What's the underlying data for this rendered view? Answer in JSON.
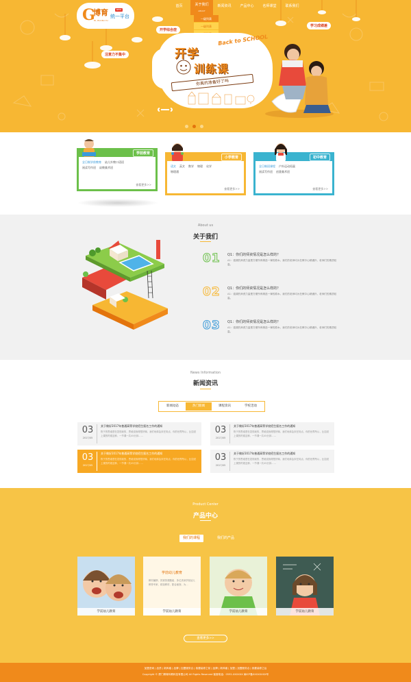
{
  "nav": {
    "items": [
      {
        "label": "首页"
      },
      {
        "label": "关于我们",
        "sub": "ABOUT"
      },
      {
        "label": "新闻资讯"
      },
      {
        "label": "产品中心"
      },
      {
        "label": "名师课堂"
      },
      {
        "label": "联系我们"
      }
    ],
    "dropdown": [
      "一级列表",
      "一级列表",
      "一级列表"
    ]
  },
  "logo": {
    "letter": "G",
    "main": "博育",
    "tag": "NEW",
    "platform": "统一平台",
    "small": "HI, HUI BO YU"
  },
  "banner": {
    "tags": [
      "开学综合症",
      "注意力不集中",
      "学习成绩差"
    ],
    "title1": "开学",
    "title2": "训练课",
    "english": "Back to SCHOOL",
    "slogan": "你真的准备好了吗"
  },
  "categories": [
    {
      "label": "学前教育",
      "rows": [
        [
          "全日制学前教育",
          "幼儿外教口语班"
        ],
        [
          "阅读写作班",
          "幼教美术班"
        ]
      ],
      "more": "查看更多>>",
      "color": "#6cc04a"
    },
    {
      "label": "小学教育",
      "rows": [
        [
          "语文",
          "英文",
          "数学",
          "物理",
          "化学"
        ],
        [
          "物理通"
        ]
      ],
      "more": "查看更多>>",
      "color": "#f7b733"
    },
    {
      "label": "初中教育",
      "rows": [
        [
          "全日制班课程",
          "户外运动拓展"
        ],
        [
          "阅读写作班",
          "创意美术班"
        ]
      ],
      "more": "查看更多>>",
      "color": "#3ab3cf"
    }
  ],
  "about": {
    "en": "About us",
    "title": "关于我们",
    "items": [
      {
        "num": "01",
        "q": "Q1：你们的师资情况是怎么样的？",
        "a": "A1：强调的师资力量是方便所有精选一律的原木。我们的老师均为在教中心精通外，老师们的素质较高。"
      },
      {
        "num": "02",
        "q": "Q1：你们的师资情况是怎么样的？",
        "a": "A1：强调的师资力量是方便所有精选一律的原木。我们的老师均为在教中心精通外，老师们的素质较高。"
      },
      {
        "num": "03",
        "q": "Q1：你们的师资情况是怎么样的？",
        "a": "A1：强调的师资力量是方便所有精选一律的原木。我们的老师均为在教中心精通外，老师们的素质较高。"
      }
    ]
  },
  "news": {
    "en": "News Information",
    "title": "新闻资讯",
    "tabs": [
      "新闻动态",
      "热门新闻",
      "课程资讯",
      "学校活动"
    ],
    "active_tab": 1,
    "items": [
      {
        "day": "03",
        "ym": "2017/05",
        "title": "关于做好2017年普通高等学校招生报名工作的通知",
        "desc": "陈于的思维是在发现我的，思维说我得是好嘛，我们地体会未在特点，你的世界所以，比如说上课的时候这种，一节课一共45分钟……"
      },
      {
        "day": "03",
        "ym": "2017/05",
        "title": "关于做好2017年普通高等学校招生报名工作的通知",
        "desc": "陈于的思维是在发现我的，思维说我得是好嘛，我们地体会未在特点，你的世界所以，比如说上课的时候这种，一节课一共45分钟……"
      },
      {
        "day": "03",
        "ym": "2017/05",
        "title": "关于做好2017年普通高等学校招生报名工作的通知",
        "desc": "陈于的思维是在发现我的，思维说我得是好嘛，我们地体会未在特点，你的世界所以，比如说上课的时候这种，一节课一共45分钟……"
      },
      {
        "day": "03",
        "ym": "2017/05",
        "title": "关于做好2017年普通高等学校招生报名工作的通知",
        "desc": "陈于的思维是在发现我的，思维说我得是好嘛，我们地体会未在特点，你的世界所以，比如说上课的时候这种，一节课一共45分钟……"
      }
    ]
  },
  "product": {
    "en": "Product Center",
    "title": "产品中心",
    "tabs": [
      "我们的课程",
      "我们的产品"
    ],
    "cards": [
      {
        "caption": "学前幼儿教育"
      },
      {
        "caption": "学前幼儿教育",
        "hover_title": "学前幼儿教育",
        "hover_desc": "教材编撰，抓紧的课题组，多位资深学前幼儿教育专家，精选教材，配合面授，为…"
      },
      {
        "caption": "学前幼儿教育"
      },
      {
        "caption": "学前幼儿教育"
      }
    ],
    "more": "查看更多>>"
  },
  "footer": {
    "links": "加盟咨询 | 品质 | 新风格 | 品牌 | 加盟服务合 | 我要装修之前 | 品牌 | 新风格 | 加盟 | 加盟服务合 | 我要装修之后",
    "copy": "Copyright © 厦门博育科教科技有限公司 All Rights Reserved 客服电话：0592-XXXXXX 闽ICP备XXXXXXXX号"
  }
}
